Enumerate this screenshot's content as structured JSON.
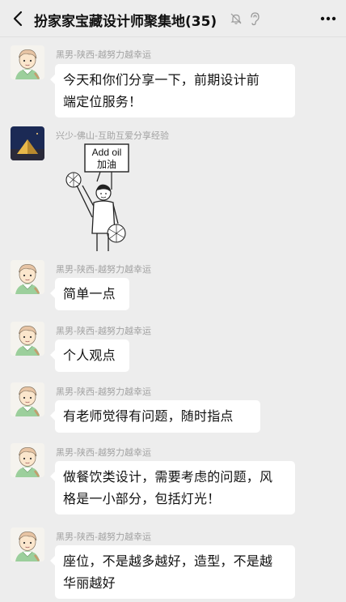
{
  "header": {
    "title": "扮家家宝藏设计师聚集地(35)",
    "back_icon": "chevron-left-icon",
    "mute_icon": "bell-muted-icon",
    "ear_icon": "ear-icon",
    "more_icon": "ellipsis-icon"
  },
  "messages": [
    {
      "sender": "黑男-陕西-越努力越幸运",
      "text_lines": [
        "今天和你们分享一下，前期设计前",
        "端定位服务！"
      ]
    },
    {
      "sender": "兴少-佛山-互助互爱分享经验",
      "sticker": {
        "line1": "Add oil",
        "line2": "加油"
      }
    },
    {
      "sender": "黑男-陕西-越努力越幸运",
      "text_lines": [
        "简单一点"
      ]
    },
    {
      "sender": "黑男-陕西-越努力越幸运",
      "text_lines": [
        "个人观点"
      ]
    },
    {
      "sender": "黑男-陕西-越努力越幸运",
      "text_lines": [
        "有老师觉得有问题，随时指点"
      ]
    },
    {
      "sender": "黑男-陕西-越努力越幸运",
      "text_lines": [
        "做餐饮类设计，需要考虑的问题，风",
        "格是一小部分，包括灯光！"
      ]
    },
    {
      "sender": "黑男-陕西-越努力越幸运",
      "text_lines": [
        "座位，不是越多越好，造型，不是越",
        "华丽越好"
      ]
    }
  ]
}
